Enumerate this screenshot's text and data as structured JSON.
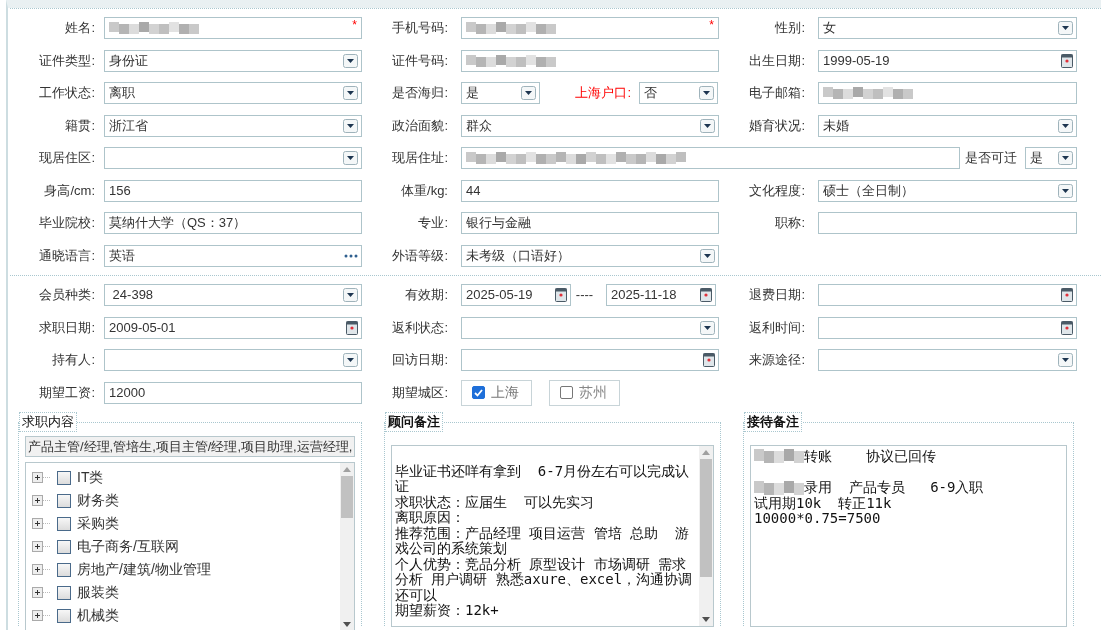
{
  "sections": [
    {
      "rows": [
        [
          {
            "kind": "single",
            "label": "姓名:",
            "controls": [
              {
                "kind": "masked",
                "mark": "*"
              }
            ]
          },
          {
            "kind": "single",
            "label": "手机号码:",
            "controls": [
              {
                "kind": "masked",
                "mark": "*"
              }
            ]
          },
          {
            "kind": "single",
            "label": "性别:",
            "controls": [
              {
                "kind": "select",
                "value": "女"
              }
            ]
          }
        ],
        [
          {
            "kind": "single",
            "label": "证件类型:",
            "controls": [
              {
                "kind": "select",
                "value": "身份证"
              }
            ]
          },
          {
            "kind": "single",
            "label": "证件号码:",
            "controls": [
              {
                "kind": "masked"
              }
            ]
          },
          {
            "kind": "single",
            "label": "出生日期:",
            "controls": [
              {
                "kind": "date",
                "value": "1999-05-19"
              }
            ]
          }
        ],
        [
          {
            "kind": "single",
            "label": "工作状态:",
            "controls": [
              {
                "kind": "select",
                "value": "离职"
              }
            ]
          },
          {
            "kind": "pair",
            "label": "是否海归:",
            "controls": [
              {
                "kind": "select",
                "value": "是"
              },
              {
                "kind": "label",
                "text": "上海户口:",
                "highlight": true
              },
              {
                "kind": "select",
                "value": "否"
              }
            ]
          },
          {
            "kind": "single",
            "label": "电子邮箱:",
            "controls": [
              {
                "kind": "masked"
              }
            ]
          }
        ],
        [
          {
            "kind": "single",
            "label": "籍贯:",
            "controls": [
              {
                "kind": "select",
                "value": "浙江省"
              }
            ]
          },
          {
            "kind": "single",
            "label": "政治面貌:",
            "controls": [
              {
                "kind": "select",
                "value": "群众"
              }
            ]
          },
          {
            "kind": "single",
            "label": "婚育状况:",
            "controls": [
              {
                "kind": "select",
                "value": "未婚"
              }
            ]
          }
        ],
        [
          {
            "kind": "single",
            "label": "现居住区:",
            "controls": [
              {
                "kind": "select"
              }
            ]
          },
          {
            "kind": "wide",
            "label": "现居住址:",
            "controls": [
              {
                "kind": "masked"
              },
              {
                "kind": "label",
                "text": "是否可迁",
                "highlight": false
              },
              {
                "kind": "select",
                "value": "是"
              }
            ]
          }
        ],
        [
          {
            "kind": "single",
            "label": "身高/cm:",
            "controls": [
              {
                "kind": "text",
                "value": "156"
              }
            ]
          },
          {
            "kind": "single",
            "label": "体重/kg:",
            "controls": [
              {
                "kind": "text",
                "value": "44"
              }
            ]
          },
          {
            "kind": "single",
            "label": "文化程度:",
            "controls": [
              {
                "kind": "select",
                "value": "硕士（全日制）"
              }
            ]
          }
        ],
        [
          {
            "kind": "single",
            "label": "毕业院校:",
            "controls": [
              {
                "kind": "text",
                "value": "莫纳什大学（QS：37）"
              }
            ]
          },
          {
            "kind": "single",
            "label": "专业:",
            "controls": [
              {
                "kind": "text",
                "value": "银行与金融"
              }
            ]
          },
          {
            "kind": "single",
            "label": "职称:",
            "controls": [
              {
                "kind": "text"
              }
            ]
          }
        ],
        [
          {
            "kind": "single",
            "label": "通晓语言:",
            "controls": [
              {
                "kind": "lookup",
                "value": "英语"
              }
            ]
          },
          {
            "kind": "single",
            "label": "外语等级:",
            "controls": [
              {
                "kind": "select",
                "value": "未考级（口语好）"
              }
            ]
          }
        ]
      ]
    },
    {
      "rows": [
        [
          {
            "kind": "single",
            "label": "会员种类:",
            "controls": [
              {
                "kind": "select",
                "value": " 24-398"
              }
            ]
          },
          {
            "kind": "range",
            "label": "有效期:",
            "controls": [
              {
                "kind": "date",
                "value": "2025-05-19"
              },
              {
                "kind": "label",
                "text": "----",
                "highlight": false
              },
              {
                "kind": "date",
                "value": "2025-11-18"
              }
            ]
          },
          {
            "kind": "single",
            "label": "退费日期:",
            "controls": [
              {
                "kind": "date"
              }
            ]
          }
        ],
        [
          {
            "kind": "single",
            "label": "求职日期:",
            "controls": [
              {
                "kind": "date",
                "value": "2009-05-01"
              }
            ]
          },
          {
            "kind": "single",
            "label": "返利状态:",
            "controls": [
              {
                "kind": "select"
              }
            ]
          },
          {
            "kind": "single",
            "label": "返利时间:",
            "controls": [
              {
                "kind": "date"
              }
            ]
          }
        ],
        [
          {
            "kind": "single",
            "label": "持有人:",
            "controls": [
              {
                "kind": "select"
              }
            ]
          },
          {
            "kind": "single",
            "label": "回访日期:",
            "controls": [
              {
                "kind": "date"
              }
            ]
          },
          {
            "kind": "single",
            "label": "来源途径:",
            "controls": [
              {
                "kind": "select"
              }
            ]
          }
        ],
        [
          {
            "kind": "single",
            "label": "期望工资:",
            "controls": [
              {
                "kind": "text",
                "value": "12000"
              }
            ]
          },
          {
            "kind": "choices",
            "label": "期望城区:",
            "controls": [
              {
                "kind": "check",
                "text": "上海",
                "checked": true
              },
              {
                "kind": "check",
                "text": "苏州",
                "checked": false
              }
            ]
          }
        ]
      ]
    }
  ],
  "panels": [
    {
      "kind": "tree",
      "title": "求职内容",
      "bold": false,
      "selection": "产品主管/经理,管培生,项目主管/经理,项目助理,运营经理,",
      "items": [
        {
          "label": "IT类",
          "checked": false,
          "expanded": false
        },
        {
          "label": "财务类",
          "checked": false,
          "expanded": false
        },
        {
          "label": "采购类",
          "checked": false,
          "expanded": false
        },
        {
          "label": "电子商务/互联网",
          "checked": false,
          "expanded": false
        },
        {
          "label": "房地产/建筑/物业管理",
          "checked": false,
          "expanded": false
        },
        {
          "label": "服装类",
          "checked": false,
          "expanded": false
        },
        {
          "label": "机械类",
          "checked": false,
          "expanded": false
        }
      ]
    },
    {
      "kind": "notes",
      "title": "顾问备注",
      "bold": true,
      "scrollable": true,
      "lines": [
        {
          "text": "毕业证书还咩有拿到  6-7月份左右可以完成认证",
          "gap_before": true,
          "masked": false
        },
        {
          "text": "求职状态：应届生  可以先实习",
          "gap_before": false,
          "masked": false
        },
        {
          "text": "离职原因：",
          "gap_before": false,
          "masked": false
        },
        {
          "text": "推荐范围：产品经理 项目运营 管培 总助  游戏公司的系统策划",
          "gap_before": false,
          "masked": false
        },
        {
          "text": "个人优势：竞品分析 原型设计 市场调研 需求分析 用户调研 熟悉axure、excel，沟通协调还可以",
          "gap_before": false,
          "masked": false
        },
        {
          "text": "期望薪资：12k+",
          "gap_before": false,
          "masked": false
        }
      ]
    },
    {
      "kind": "notes",
      "title": "接待备注",
      "bold": true,
      "scrollable": false,
      "lines": [
        {
          "text": "转账    协议已回传",
          "gap_before": false,
          "masked": true
        },
        {
          "text": "录用  产品专员   6-9入职",
          "gap_before": true,
          "masked": true
        },
        {
          "text": "试用期10k  转正11k",
          "gap_before": false,
          "masked": false
        },
        {
          "text": "10000*0.75=7500",
          "gap_before": false,
          "masked": false
        }
      ]
    }
  ]
}
